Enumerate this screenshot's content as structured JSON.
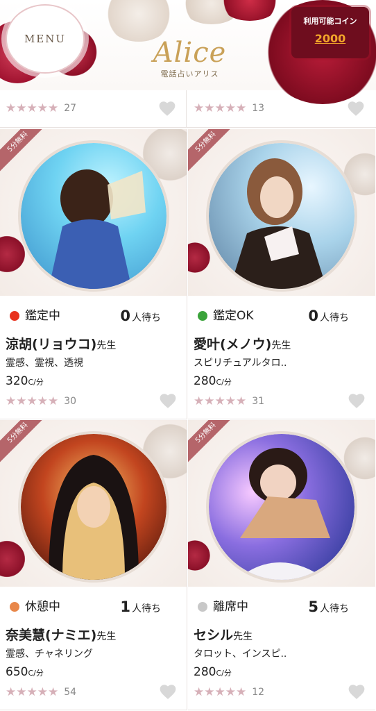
{
  "header": {
    "menu_label": "MENU",
    "logo_text": "Alice",
    "logo_subtitle": "電話占いアリス",
    "coin_label": "利用可能コイン",
    "coin_value": "2000"
  },
  "partial_row": [
    {
      "stars": "★★★★★",
      "count": "27"
    },
    {
      "stars": "★★★★★",
      "count": "13"
    }
  ],
  "cards": [
    {
      "ribbon": "5分無料",
      "status": "鑑定中",
      "status_color": "#e8321e",
      "wait_num": "0",
      "wait_label": "人待ち",
      "name": "涼胡(リョウコ)",
      "suffix": "先生",
      "genre": "霊感、霊視、透視",
      "price": "320",
      "price_unit": "C/分",
      "stars": "★★★★★",
      "count": "30"
    },
    {
      "ribbon": "5分無料",
      "status": "鑑定OK",
      "status_color": "#3aa33a",
      "wait_num": "0",
      "wait_label": "人待ち",
      "name": "愛叶(メノウ)",
      "suffix": "先生",
      "genre": "スピリチュアルタロ..",
      "price": "280",
      "price_unit": "C/分",
      "stars": "★★★★★",
      "count": "31"
    },
    {
      "ribbon": "5分無料",
      "status": "休憩中",
      "status_color": "#e8874a",
      "wait_num": "1",
      "wait_label": "人待ち",
      "name": "奈美慧(ナミエ)",
      "suffix": "先生",
      "genre": "霊感、チャネリング",
      "price": "650",
      "price_unit": "C/分",
      "stars": "★★★★★",
      "count": "54"
    },
    {
      "ribbon": "5分無料",
      "status": "離席中",
      "status_color": "#c8c8c8",
      "wait_num": "5",
      "wait_label": "人待ち",
      "name": "セシル",
      "suffix": "先生",
      "genre": "タロット、インスピ..",
      "price": "280",
      "price_unit": "C/分",
      "stars": "★★★★★",
      "count": "12"
    }
  ],
  "icons": {
    "favorite": "heart-icon",
    "status": "status-dot-icon"
  },
  "colors": {
    "accent": "#b5656a",
    "coin_bg": "#6e0d1e",
    "coin_value": "#f2a52a",
    "star": "#d6b0b8"
  }
}
